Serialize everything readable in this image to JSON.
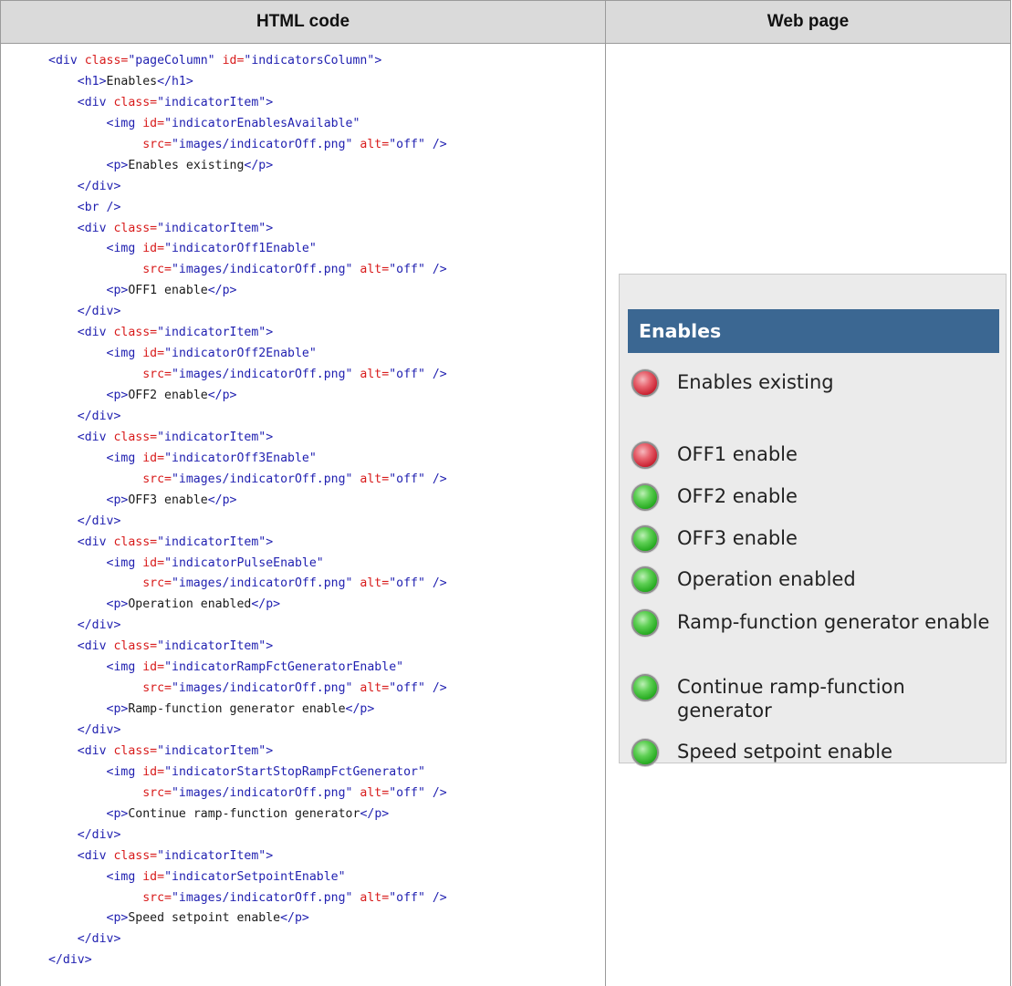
{
  "table": {
    "header_left": "HTML code",
    "header_right": "Web page"
  },
  "code": [
    [
      [
        "tg",
        "<div "
      ],
      [
        "at",
        "class="
      ],
      [
        "vl",
        "\"pageColumn\" "
      ],
      [
        "at",
        "id="
      ],
      [
        "vl",
        "\"indicatorsColumn\""
      ],
      [
        "tg",
        ">"
      ]
    ],
    [
      [
        "tx",
        "    "
      ],
      [
        "tg",
        "<h1>"
      ],
      [
        "tx",
        "Enables"
      ],
      [
        "tg",
        "</h1>"
      ]
    ],
    [
      [
        "tx",
        "    "
      ],
      [
        "tg",
        "<div "
      ],
      [
        "at",
        "class="
      ],
      [
        "vl",
        "\"indicatorItem\""
      ],
      [
        "tg",
        ">"
      ]
    ],
    [
      [
        "tx",
        "        "
      ],
      [
        "tg",
        "<img "
      ],
      [
        "at",
        "id="
      ],
      [
        "vl",
        "\"indicatorEnablesAvailable\""
      ]
    ],
    [
      [
        "tx",
        "             "
      ],
      [
        "at",
        "src="
      ],
      [
        "vl",
        "\"images/indicatorOff.png\" "
      ],
      [
        "at",
        "alt="
      ],
      [
        "vl",
        "\"off\" "
      ],
      [
        "tg",
        "/>"
      ]
    ],
    [
      [
        "tx",
        "        "
      ],
      [
        "tg",
        "<p>"
      ],
      [
        "tx",
        "Enables existing"
      ],
      [
        "tg",
        "</p>"
      ]
    ],
    [
      [
        "tx",
        "    "
      ],
      [
        "tg",
        "</div>"
      ]
    ],
    [
      [
        "tx",
        "    "
      ],
      [
        "tg",
        "<br />"
      ]
    ],
    [
      [
        "tx",
        "    "
      ],
      [
        "tg",
        "<div "
      ],
      [
        "at",
        "class="
      ],
      [
        "vl",
        "\"indicatorItem\""
      ],
      [
        "tg",
        ">"
      ]
    ],
    [
      [
        "tx",
        "        "
      ],
      [
        "tg",
        "<img "
      ],
      [
        "at",
        "id="
      ],
      [
        "vl",
        "\"indicatorOff1Enable\""
      ]
    ],
    [
      [
        "tx",
        "             "
      ],
      [
        "at",
        "src="
      ],
      [
        "vl",
        "\"images/indicatorOff.png\" "
      ],
      [
        "at",
        "alt="
      ],
      [
        "vl",
        "\"off\" "
      ],
      [
        "tg",
        "/>"
      ]
    ],
    [
      [
        "tx",
        "        "
      ],
      [
        "tg",
        "<p>"
      ],
      [
        "tx",
        "OFF1 enable"
      ],
      [
        "tg",
        "</p>"
      ]
    ],
    [
      [
        "tx",
        "    "
      ],
      [
        "tg",
        "</div>"
      ]
    ],
    [
      [
        "tx",
        "    "
      ],
      [
        "tg",
        "<div "
      ],
      [
        "at",
        "class="
      ],
      [
        "vl",
        "\"indicatorItem\""
      ],
      [
        "tg",
        ">"
      ]
    ],
    [
      [
        "tx",
        "        "
      ],
      [
        "tg",
        "<img "
      ],
      [
        "at",
        "id="
      ],
      [
        "vl",
        "\"indicatorOff2Enable\""
      ]
    ],
    [
      [
        "tx",
        "             "
      ],
      [
        "at",
        "src="
      ],
      [
        "vl",
        "\"images/indicatorOff.png\" "
      ],
      [
        "at",
        "alt="
      ],
      [
        "vl",
        "\"off\" "
      ],
      [
        "tg",
        "/>"
      ]
    ],
    [
      [
        "tx",
        "        "
      ],
      [
        "tg",
        "<p>"
      ],
      [
        "tx",
        "OFF2 enable"
      ],
      [
        "tg",
        "</p>"
      ]
    ],
    [
      [
        "tx",
        "    "
      ],
      [
        "tg",
        "</div>"
      ]
    ],
    [
      [
        "tx",
        "    "
      ],
      [
        "tg",
        "<div "
      ],
      [
        "at",
        "class="
      ],
      [
        "vl",
        "\"indicatorItem\""
      ],
      [
        "tg",
        ">"
      ]
    ],
    [
      [
        "tx",
        "        "
      ],
      [
        "tg",
        "<img "
      ],
      [
        "at",
        "id="
      ],
      [
        "vl",
        "\"indicatorOff3Enable\""
      ]
    ],
    [
      [
        "tx",
        "             "
      ],
      [
        "at",
        "src="
      ],
      [
        "vl",
        "\"images/indicatorOff.png\" "
      ],
      [
        "at",
        "alt="
      ],
      [
        "vl",
        "\"off\" "
      ],
      [
        "tg",
        "/>"
      ]
    ],
    [
      [
        "tx",
        "        "
      ],
      [
        "tg",
        "<p>"
      ],
      [
        "tx",
        "OFF3 enable"
      ],
      [
        "tg",
        "</p>"
      ]
    ],
    [
      [
        "tx",
        "    "
      ],
      [
        "tg",
        "</div>"
      ]
    ],
    [
      [
        "tx",
        "    "
      ],
      [
        "tg",
        "<div "
      ],
      [
        "at",
        "class="
      ],
      [
        "vl",
        "\"indicatorItem\""
      ],
      [
        "tg",
        ">"
      ]
    ],
    [
      [
        "tx",
        "        "
      ],
      [
        "tg",
        "<img "
      ],
      [
        "at",
        "id="
      ],
      [
        "vl",
        "\"indicatorPulseEnable\""
      ]
    ],
    [
      [
        "tx",
        "             "
      ],
      [
        "at",
        "src="
      ],
      [
        "vl",
        "\"images/indicatorOff.png\" "
      ],
      [
        "at",
        "alt="
      ],
      [
        "vl",
        "\"off\" "
      ],
      [
        "tg",
        "/>"
      ]
    ],
    [
      [
        "tx",
        "        "
      ],
      [
        "tg",
        "<p>"
      ],
      [
        "tx",
        "Operation enabled"
      ],
      [
        "tg",
        "</p>"
      ]
    ],
    [
      [
        "tx",
        "    "
      ],
      [
        "tg",
        "</div>"
      ]
    ],
    [
      [
        "tx",
        "    "
      ],
      [
        "tg",
        "<div "
      ],
      [
        "at",
        "class="
      ],
      [
        "vl",
        "\"indicatorItem\""
      ],
      [
        "tg",
        ">"
      ]
    ],
    [
      [
        "tx",
        "        "
      ],
      [
        "tg",
        "<img "
      ],
      [
        "at",
        "id="
      ],
      [
        "vl",
        "\"indicatorRampFctGeneratorEnable\""
      ]
    ],
    [
      [
        "tx",
        "             "
      ],
      [
        "at",
        "src="
      ],
      [
        "vl",
        "\"images/indicatorOff.png\" "
      ],
      [
        "at",
        "alt="
      ],
      [
        "vl",
        "\"off\" "
      ],
      [
        "tg",
        "/>"
      ]
    ],
    [
      [
        "tx",
        "        "
      ],
      [
        "tg",
        "<p>"
      ],
      [
        "tx",
        "Ramp-function generator enable"
      ],
      [
        "tg",
        "</p>"
      ]
    ],
    [
      [
        "tx",
        "    "
      ],
      [
        "tg",
        "</div>"
      ]
    ],
    [
      [
        "tx",
        "    "
      ],
      [
        "tg",
        "<div "
      ],
      [
        "at",
        "class="
      ],
      [
        "vl",
        "\"indicatorItem\""
      ],
      [
        "tg",
        ">"
      ]
    ],
    [
      [
        "tx",
        "        "
      ],
      [
        "tg",
        "<img "
      ],
      [
        "at",
        "id="
      ],
      [
        "vl",
        "\"indicatorStartStopRampFctGenerator\""
      ]
    ],
    [
      [
        "tx",
        "             "
      ],
      [
        "at",
        "src="
      ],
      [
        "vl",
        "\"images/indicatorOff.png\" "
      ],
      [
        "at",
        "alt="
      ],
      [
        "vl",
        "\"off\" "
      ],
      [
        "tg",
        "/>"
      ]
    ],
    [
      [
        "tx",
        "        "
      ],
      [
        "tg",
        "<p>"
      ],
      [
        "tx",
        "Continue ramp-function generator"
      ],
      [
        "tg",
        "</p>"
      ]
    ],
    [
      [
        "tx",
        "    "
      ],
      [
        "tg",
        "</div>"
      ]
    ],
    [
      [
        "tx",
        "    "
      ],
      [
        "tg",
        "<div "
      ],
      [
        "at",
        "class="
      ],
      [
        "vl",
        "\"indicatorItem\""
      ],
      [
        "tg",
        ">"
      ]
    ],
    [
      [
        "tx",
        "        "
      ],
      [
        "tg",
        "<img "
      ],
      [
        "at",
        "id="
      ],
      [
        "vl",
        "\"indicatorSetpointEnable\""
      ]
    ],
    [
      [
        "tx",
        "             "
      ],
      [
        "at",
        "src="
      ],
      [
        "vl",
        "\"images/indicatorOff.png\" "
      ],
      [
        "at",
        "alt="
      ],
      [
        "vl",
        "\"off\" "
      ],
      [
        "tg",
        "/>"
      ]
    ],
    [
      [
        "tx",
        "        "
      ],
      [
        "tg",
        "<p>"
      ],
      [
        "tx",
        "Speed setpoint enable"
      ],
      [
        "tg",
        "</p>"
      ]
    ],
    [
      [
        "tx",
        "    "
      ],
      [
        "tg",
        "</div>"
      ]
    ],
    [
      [
        "tg",
        "</div>"
      ]
    ]
  ],
  "preview": {
    "heading": "Enables",
    "colors": {
      "heading_bg": "#3b6792",
      "panel_bg": "#ebebeb",
      "on": "#22a81d",
      "off": "#c81e2e"
    },
    "items": [
      {
        "label": "Enables existing",
        "state": "red"
      },
      {
        "label": "OFF1 enable",
        "state": "red"
      },
      {
        "label": "OFF2 enable",
        "state": "green"
      },
      {
        "label": "OFF3 enable",
        "state": "green"
      },
      {
        "label": "Operation enabled",
        "state": "green"
      },
      {
        "label": "Ramp-function generator enable",
        "state": "green"
      },
      {
        "label": "Continue ramp-function generator",
        "state": "green"
      },
      {
        "label": "Speed setpoint enable",
        "state": "green"
      }
    ]
  }
}
